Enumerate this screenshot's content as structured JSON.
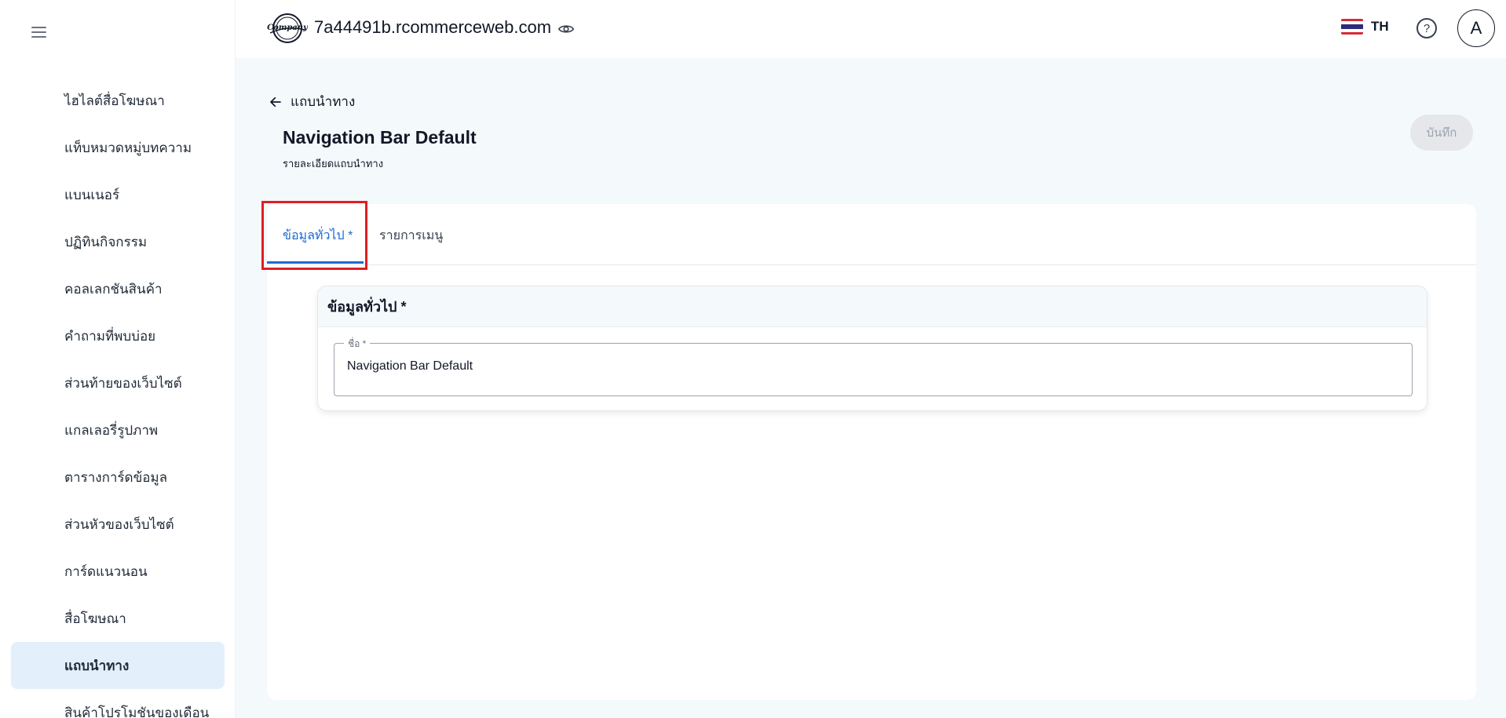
{
  "sidebar": {
    "items": [
      {
        "label": "ไฮไลต์สื่อโฆษณา"
      },
      {
        "label": "แท็บหมวดหมู่บทความ"
      },
      {
        "label": "แบนเนอร์"
      },
      {
        "label": "ปฏิทินกิจกรรม"
      },
      {
        "label": "คอลเลกชันสินค้า"
      },
      {
        "label": "คำถามที่พบบ่อย"
      },
      {
        "label": "ส่วนท้ายของเว็บไซต์"
      },
      {
        "label": "แกลเลอรี่รูปภาพ"
      },
      {
        "label": "ตารางการ์ดข้อมูล"
      },
      {
        "label": "ส่วนหัวของเว็บไซต์"
      },
      {
        "label": "การ์ดแนวนอน"
      },
      {
        "label": "สื่อโฆษณา"
      },
      {
        "label": "แถบนำทาง",
        "active": true
      },
      {
        "label": "สินค้าโปรโมชันของเดือน"
      }
    ]
  },
  "header": {
    "logo_text": "Company",
    "site_name": "7a44491b.rcommerceweb.com",
    "language": "TH",
    "help_symbol": "?",
    "avatar_initial": "A"
  },
  "main": {
    "back_label": "แถบนำทาง",
    "title": "Navigation Bar Default",
    "subtitle": "รายละเอียดแถบนำทาง",
    "save_label": "บันทึก",
    "tabs": [
      {
        "label": "ข้อมูลทั่วไป *",
        "active": true
      },
      {
        "label": "รายการเมนู",
        "active": false
      }
    ],
    "section": {
      "title": "ข้อมูลทั่วไป *",
      "name_field": {
        "label": "ชื่อ *",
        "value": "Navigation Bar Default"
      }
    }
  },
  "colors": {
    "accent": "#1b6ad1",
    "highlight": "#e11d24",
    "active_nav_bg": "#e3f0fb"
  }
}
